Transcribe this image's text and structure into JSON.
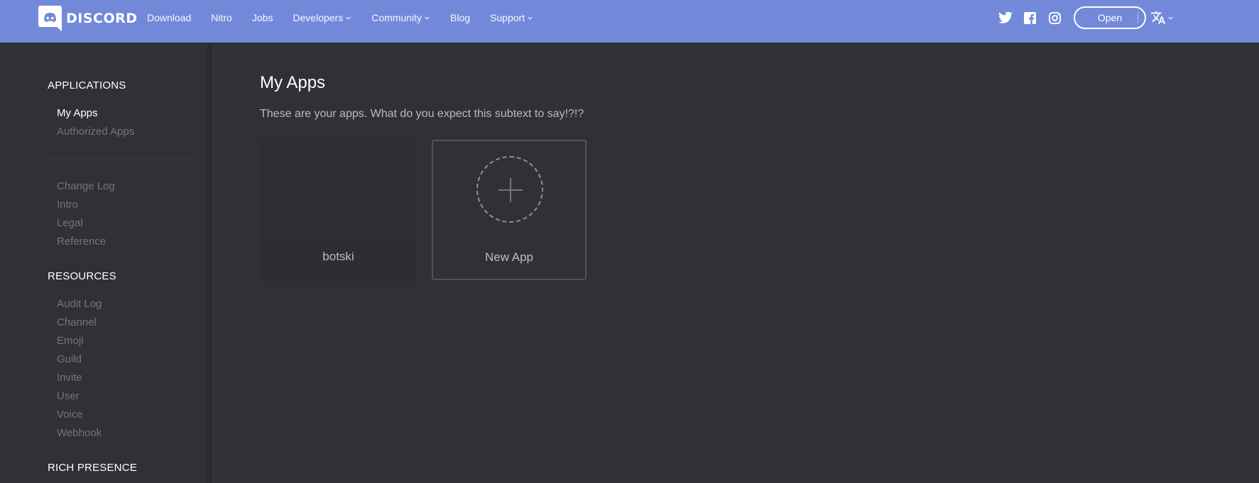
{
  "brand": {
    "name": "DISCORD",
    "icon": "discord-logo-icon",
    "accent_color": "#7289da"
  },
  "nav": {
    "items": [
      {
        "label": "Download",
        "has_dropdown": false
      },
      {
        "label": "Nitro",
        "has_dropdown": false
      },
      {
        "label": "Jobs",
        "has_dropdown": false
      },
      {
        "label": "Developers",
        "has_dropdown": true
      },
      {
        "label": "Community",
        "has_dropdown": true
      },
      {
        "label": "Blog",
        "has_dropdown": false
      },
      {
        "label": "Support",
        "has_dropdown": true
      }
    ],
    "social": [
      "twitter-icon",
      "facebook-icon",
      "instagram-icon"
    ],
    "open_label": "Open",
    "language_icon": "translate-icon"
  },
  "sidebar": {
    "applications_heading": "APPLICATIONS",
    "applications": [
      {
        "label": "My Apps",
        "active": true
      },
      {
        "label": "Authorized Apps",
        "active": false
      }
    ],
    "docs": [
      {
        "label": "Change Log"
      },
      {
        "label": "Intro"
      },
      {
        "label": "Legal"
      },
      {
        "label": "Reference"
      }
    ],
    "resources_heading": "RESOURCES",
    "resources": [
      {
        "label": "Audit Log"
      },
      {
        "label": "Channel"
      },
      {
        "label": "Emoji"
      },
      {
        "label": "Guild"
      },
      {
        "label": "Invite"
      },
      {
        "label": "User"
      },
      {
        "label": "Voice"
      },
      {
        "label": "Webhook"
      }
    ],
    "rich_presence_heading": "RICH PRESENCE"
  },
  "main": {
    "title": "My Apps",
    "subtitle": "These are your apps. What do you expect this subtext to say!?!?",
    "apps": [
      {
        "name": "botski"
      }
    ],
    "new_app_label": "New App"
  }
}
